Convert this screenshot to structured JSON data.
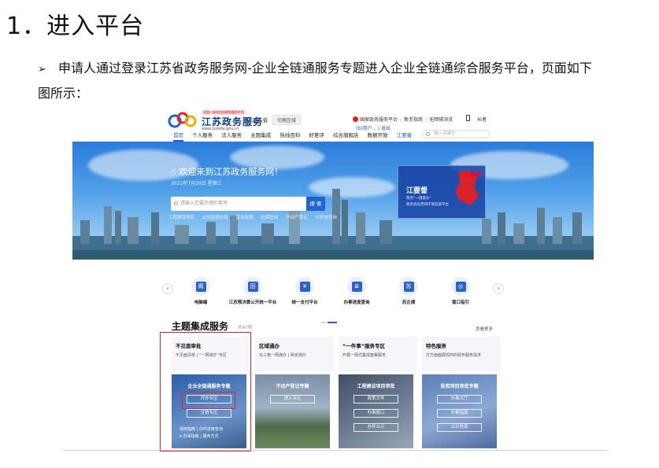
{
  "doc": {
    "heading": "1．进入平台",
    "bullet": "➢",
    "para_line1": "申请人通过登录江苏省政务服务网-企业全链通服务专题进入企业全链通综合服务平台，页面如下",
    "para_line2": "图所示："
  },
  "site": {
    "logo_badge": "全国一体化在线政务服务平台",
    "logo_name": "江苏政务服务",
    "logo_url": "www.jszwfw.gov.cn",
    "province": "江苏省",
    "region_btn": "切换区域",
    "top_links": [
      "国家政务服务平台",
      "新手指南",
      "无障碍浏览"
    ],
    "elder": "长者",
    "user": "(b)用户... | 退出",
    "nav": [
      "首页",
      "个人服务",
      "法人服务",
      "主题集成",
      "热线百科",
      "好差评",
      "综合旗舰店",
      "数据开放",
      "江要督"
    ],
    "search_placeholder": "输入关键字"
  },
  "banner": {
    "welcome": "欢迎来到江苏政务服务网！",
    "date": "2022年7月20日 星期三",
    "search_placeholder": "请输入您要办理的事项",
    "search_btn": "搜 索",
    "hot": [
      "工程建设项目",
      "公共资源交易",
      "营业执照",
      "社保查询",
      "不动产登记",
      "公积金查询"
    ],
    "jyd_title": "江要督",
    "jyd_sub1": "政务“一键督办”",
    "jyd_sub2": "政务优化营商环境监督平台",
    "jyd_seal": "江苏督"
  },
  "quick": {
    "items": [
      {
        "label": "电脑端",
        "glyph": "阁"
      },
      {
        "label": "江苏预决算公开统一平台",
        "glyph": "田"
      },
      {
        "label": "统一支付平台",
        "glyph": "¥"
      },
      {
        "label": "办事进度查询",
        "glyph": "≣"
      },
      {
        "label": "苏企通",
        "glyph": "苏"
      },
      {
        "label": "窗口指引",
        "glyph": "◎"
      }
    ],
    "prev": "‹",
    "next": "›"
  },
  "theme": {
    "title": "主题集成服务",
    "count": "共97项",
    "more": "查看更多",
    "cats": [
      {
        "title": "不见面审批",
        "desc": "不见面清单 | “一网通办”专区"
      },
      {
        "title": "区域通办",
        "desc": "长三角一网通办 | 跨省通办"
      },
      {
        "title": "“一件事”服务专区",
        "desc": "开展一网式集成套餐服务"
      },
      {
        "title": "特色服务",
        "desc": "方方面面展现你的政务服务需求"
      }
    ],
    "cards": [
      {
        "title": "企业全链通服务专题",
        "buttons": [
          "开办专区",
          "注销专区"
        ],
        "foot1": "常用指南 | 办件进度查询",
        "foot2": "e 办事指南 | 服务方式"
      },
      {
        "title": "不动产登记专题",
        "buttons": [
          "进入专区"
        ]
      },
      {
        "title": "工程建设项目审批",
        "buttons": [
          "政策文件",
          "办事窗口",
          "办件公示"
        ]
      },
      {
        "title": "投资项目审批专题",
        "buttons": [
          "办事大厅",
          "办事指南",
          "公示信息"
        ]
      }
    ]
  },
  "colors": {
    "accent": "#1e63d0",
    "highlight": "#e0262b"
  }
}
